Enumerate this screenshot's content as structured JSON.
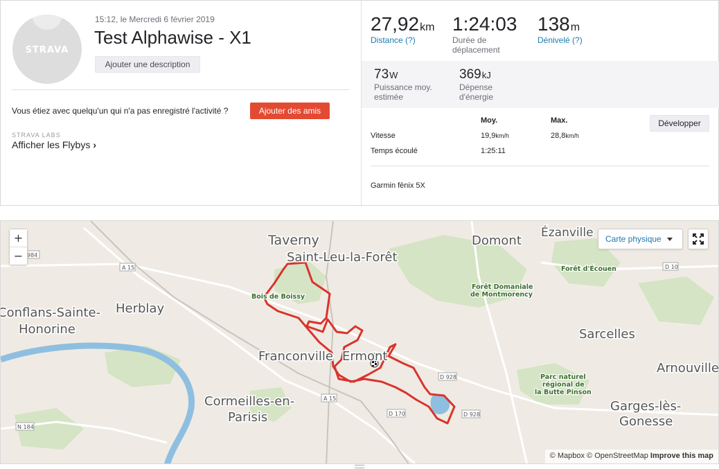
{
  "activity": {
    "avatar_brand": "STRAVA",
    "date": "15:12, le Mercredi 6 février 2019",
    "title": "Test Alphawise - X1",
    "add_description_label": "Ajouter une description",
    "friends_prompt": "Vous étiez avec quelqu'un qui n'a pas enregistré l'activité ?",
    "add_friends_label": "Ajouter des amis",
    "labs_label": "STRAVA LABS",
    "flybys_label": "Afficher les Flybys",
    "flybys_chevron": "›"
  },
  "stats": {
    "distance": {
      "value": "27,92",
      "unit": "km",
      "label": "Distance (?)"
    },
    "moving_time": {
      "value": "1:24:03",
      "label": "Durée de déplacement"
    },
    "elevation": {
      "value": "138",
      "unit": "m",
      "label": "Dénivelé (?)"
    },
    "power": {
      "value": "73",
      "unit": "W",
      "label": "Puissance moy. estimée"
    },
    "energy": {
      "value": "369",
      "unit": "kJ",
      "label": "Dépense d'énergie"
    }
  },
  "details": {
    "expand_label": "Développer",
    "col_avg": "Moy.",
    "col_max": "Max.",
    "rows": [
      {
        "label": "Vitesse",
        "avg": "19,9",
        "avg_unit": "km/h",
        "max": "28,8",
        "max_unit": "km/h"
      },
      {
        "label": "Temps écoulé",
        "avg": "1:25:11",
        "avg_unit": "",
        "max": "",
        "max_unit": ""
      }
    ],
    "device": "Garmin fēnix 5X"
  },
  "map": {
    "zoom_in": "+",
    "zoom_out": "−",
    "map_type": "Carte physique",
    "fullscreen_icon": "fullscreen-icon",
    "attribution_mapbox": "© Mapbox",
    "attribution_osm": "© OpenStreetMap",
    "attribution_improve": "Improve this map",
    "route_color": "#d9332c",
    "places": {
      "taverny": "Taverny",
      "saint_leu": "Saint-Leu-la-Forêt",
      "domont": "Domont",
      "ezanville": "Ézanville",
      "conflans_1": "Conflans-Sainte-",
      "conflans_2": "Honorine",
      "herblay": "Herblay",
      "franconville": "Franconville",
      "ermont": "Ermont",
      "sarcelles": "Sarcelles",
      "arnouville": "Arnouville",
      "cormeilles_1": "Cormeilles-en-",
      "cormeilles_2": "Parisis",
      "garges_1": "Garges-lès-",
      "garges_2": "Gonesse"
    },
    "forests": {
      "boissy": "Bois de Boissy",
      "ecouen": "Forêt d'Écouen",
      "montmorency_1": "Forêt Domaniale",
      "montmorency_2": "de Montmorency",
      "butte_1": "Parc naturel",
      "butte_2": "régional de",
      "butte_3": "la Butte Pinson"
    },
    "roads": {
      "a15_a": "A 15",
      "a15_b": "A 15",
      "d10": "D 10",
      "d928_a": "D 928",
      "d928_b": "D 928",
      "d170": "D 170",
      "n184": "N 184",
      "r984": "984"
    }
  }
}
